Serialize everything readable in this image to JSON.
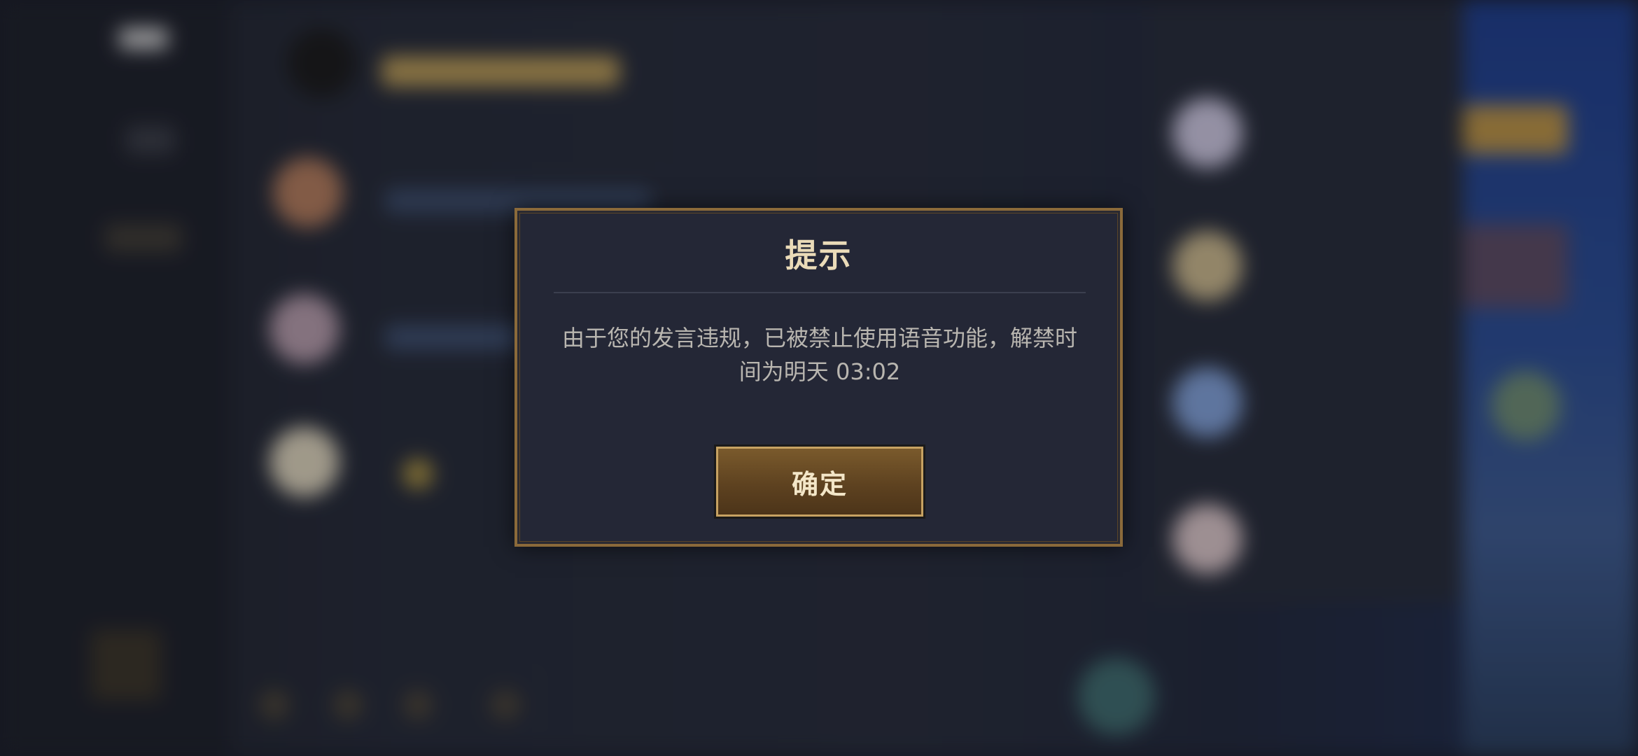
{
  "dialog": {
    "title": "提示",
    "message": "由于您的发言违规，已被禁止使用语音功能，解禁时间为明天 03:02",
    "confirm_label": "确定"
  },
  "colors": {
    "dialog_border": "#8b6a3a",
    "dialog_background": "#242736",
    "button_gold": "#c7a262",
    "title_text": "#eadbb8"
  }
}
